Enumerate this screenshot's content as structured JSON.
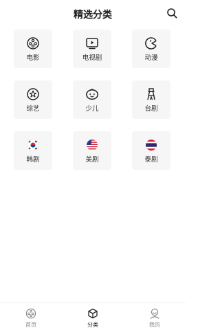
{
  "header": {
    "title": "精选分类",
    "search_icon": "search-icon"
  },
  "categories": [
    {
      "label": "电影",
      "icon": "film-reel-icon"
    },
    {
      "label": "电视剧",
      "icon": "tv-icon"
    },
    {
      "label": "动漫",
      "icon": "pacman-icon"
    },
    {
      "label": "综艺",
      "icon": "star-icon"
    },
    {
      "label": "少儿",
      "icon": "child-face-icon"
    },
    {
      "label": "台剧",
      "icon": "tower-icon"
    },
    {
      "label": "韩剧",
      "icon": "korea-flag-icon"
    },
    {
      "label": "美剧",
      "icon": "usa-flag-icon"
    },
    {
      "label": "泰剧",
      "icon": "thailand-flag-icon"
    }
  ],
  "tabbar": [
    {
      "label": "首页",
      "icon": "film-reel-icon",
      "active": false
    },
    {
      "label": "分类",
      "icon": "cube-icon",
      "active": true
    },
    {
      "label": "我的",
      "icon": "user-icon",
      "active": false
    }
  ],
  "colors": {
    "text": "#222222",
    "tile_bg": "#f6f6f6",
    "inactive_tab": "#8a8a8a"
  }
}
